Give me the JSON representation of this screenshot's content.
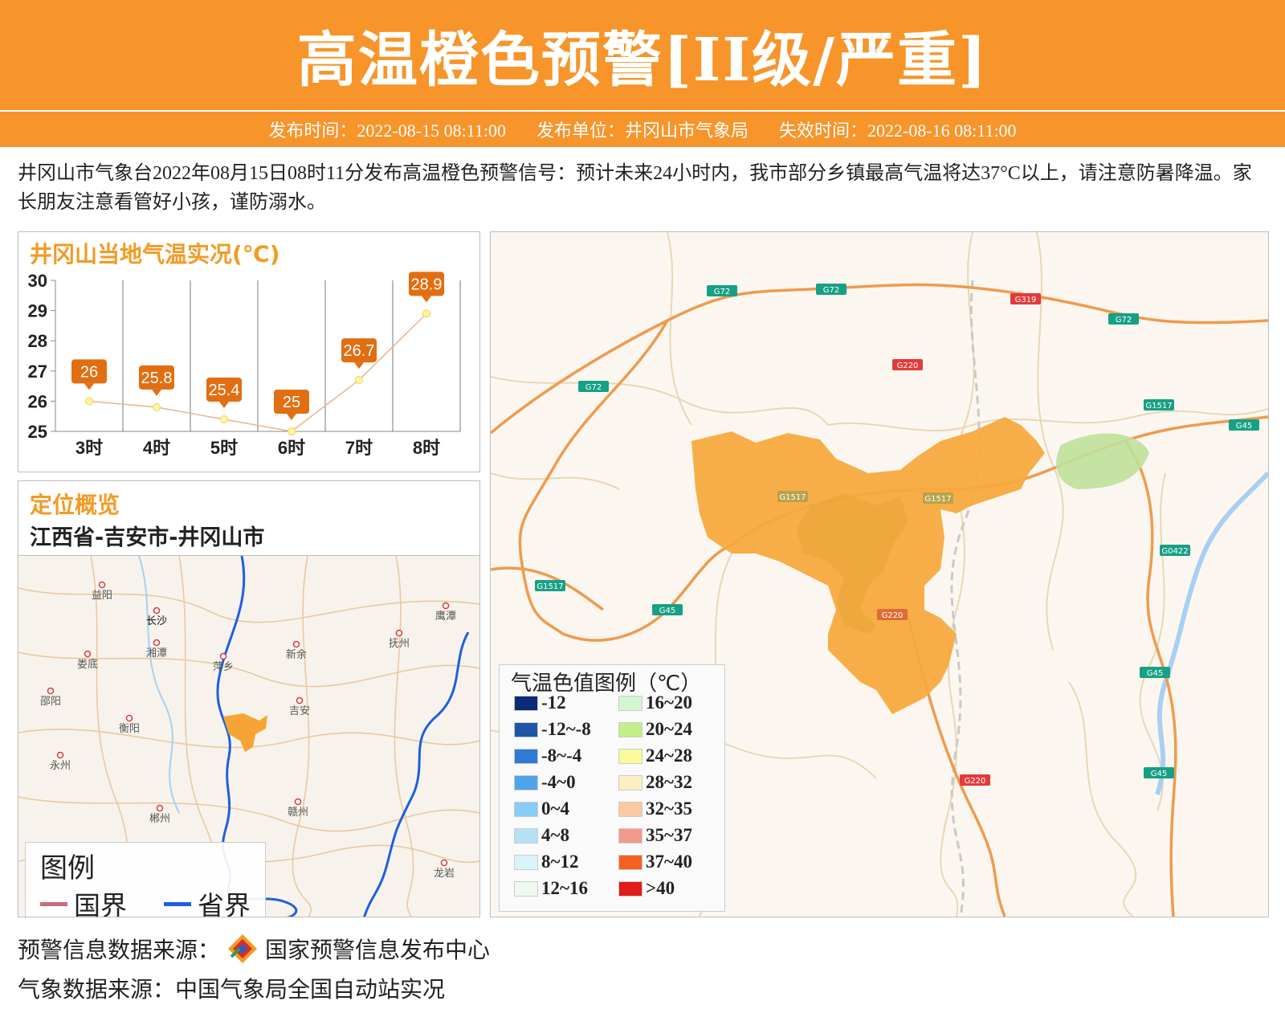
{
  "header": {
    "title": "高温橙色预警[II级/严重]"
  },
  "info_bar": {
    "publish_time": "发布时间：2022-08-15 08:11:00",
    "publisher": "发布单位：井冈山市气象局",
    "expire_time": "失效时间：2022-08-16 08:11:00"
  },
  "description": "井冈山市气象台2022年08月15日08时11分发布高温橙色预警信号：预计未来24小时内，我市部分乡镇最高气温将达37°C以上，请注意防暑降温。家长朋友注意看管好小孩，谨防溺水。",
  "temp_panel": {
    "title": "井冈山当地气温实况(℃)"
  },
  "chart_data": {
    "type": "line",
    "title": "井冈山当地气温实况(℃)",
    "categories": [
      "3时",
      "4时",
      "5时",
      "6时",
      "7时",
      "8时"
    ],
    "values": [
      26,
      25.8,
      25.4,
      25,
      26.7,
      28.9
    ],
    "yticks": [
      25,
      26,
      27,
      28,
      29,
      30
    ],
    "ylim": [
      25,
      30
    ],
    "grid": true,
    "colors": {
      "line": "#e9b48a",
      "label_bg": "#e26e12",
      "point": "#fff59d"
    }
  },
  "location_panel": {
    "title": "定位概览",
    "path": "江西省-吉安市-井冈山市",
    "cities": [
      "益阳",
      "长沙",
      "湘潭",
      "鹰潭",
      "抚州",
      "萍乡",
      "新余",
      "娄底",
      "邵阳",
      "吉安",
      "衡阳",
      "永州",
      "赣州",
      "郴州",
      "龙岩"
    ],
    "legend": {
      "title": "图例",
      "national_border": "国界",
      "province_border": "省界"
    },
    "colors": {
      "national": "#c96b7a",
      "province": "#1e5fe0",
      "highlight": "#f6a436"
    }
  },
  "main_map": {
    "road_labels": [
      "G72",
      "G72",
      "G319",
      "G72",
      "G220",
      "G72",
      "G1517",
      "G45",
      "G1517",
      "G1517",
      "G0422",
      "G1517",
      "G45",
      "G220",
      "G45",
      "G220",
      "G45"
    ],
    "legend": {
      "title": "气温色值图例（℃）",
      "items": [
        {
          "label": "-12",
          "color": "#0b2a78"
        },
        {
          "label": "-12~-8",
          "color": "#1f55a6"
        },
        {
          "label": "-8~-4",
          "color": "#2f7ad4"
        },
        {
          "label": "-4~0",
          "color": "#4fa3ec"
        },
        {
          "label": "0~4",
          "color": "#86cdf7"
        },
        {
          "label": "4~8",
          "color": "#b3e2f7"
        },
        {
          "label": "8~12",
          "color": "#d8f4fb"
        },
        {
          "label": "12~16",
          "color": "#eefaf0"
        },
        {
          "label": "16~20",
          "color": "#d2f7cf"
        },
        {
          "label": "20~24",
          "color": "#c2ef8a"
        },
        {
          "label": "24~28",
          "color": "#fbfa99"
        },
        {
          "label": "28~32",
          "color": "#fdefc4"
        },
        {
          "label": "32~35",
          "color": "#fbc9a0"
        },
        {
          "label": "35~37",
          "color": "#f49a8a"
        },
        {
          "label": "37~40",
          "color": "#f4611f"
        },
        {
          "label": ">40",
          "color": "#e21b1b"
        }
      ]
    }
  },
  "footer": {
    "warning_source": "预警信息数据来源：",
    "warning_center": "国家预警信息发布中心",
    "weather_source": "气象数据来源：中国气象局全国自动站实况"
  },
  "colors": {
    "brand_orange": "#f7942a",
    "title_orange": "#f39a24"
  }
}
